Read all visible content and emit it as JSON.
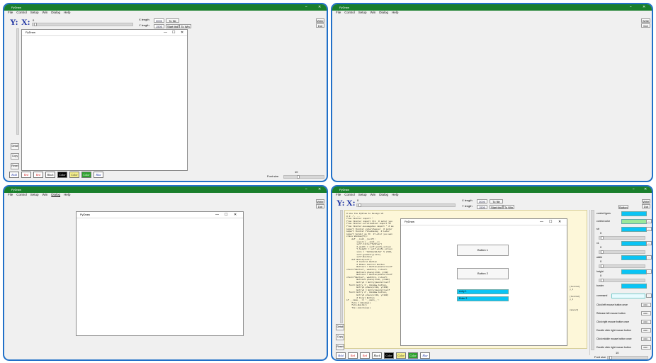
{
  "colors": {
    "title_bar": "#1a7f2c",
    "panel_border": "#2170c8",
    "editor_bg": "#fdf7d9",
    "cyan": "#0ac4f5",
    "lightgreen": "#9be89b"
  },
  "window": {
    "title": "PyDraw",
    "menu": [
      "File",
      "Control",
      "Setup",
      "Win",
      "Dialog",
      "Help"
    ]
  },
  "coords": {
    "y_label": "Y:",
    "x_label": "X:",
    "x_value": "0",
    "x_length_label": "X length",
    "x_length_value": "3000",
    "y_length_label": "Y length",
    "y_length_value": "1500",
    "to_file": "To file",
    "start_draw": "Start tbd",
    "to_win": "To Win",
    "write": "Write",
    "dot": "Dot"
  },
  "side_buttons": {
    "detail": "Detail",
    "copy": "Copy",
    "reset": "Reset"
  },
  "child_window": {
    "title": "PyDraw",
    "minimize": "—",
    "maximize": "☐",
    "close": "✕"
  },
  "color_buttons": [
    "Red",
    "Red",
    "Black",
    "Color",
    "Color",
    "Color",
    "Color",
    "Blue"
  ],
  "font_size": {
    "label": "Font size",
    "value": "10"
  },
  "p2": {
    "write": "Write",
    "dot": "Dot"
  },
  "p4": {
    "code": [
      "# Use the PyDraw to Design UI",
      "# # -*- ...",
      "from tkinter import *",
      "from tkinter import ttk  # Later you",
      "from tkinter.scrolledtext import ST",
      "from tkinter.messagebox import * # me",
      "import tkinter.colorchooser  # Later",
      "import tkinter.filedialog  # Later",
      "import holder as th  # Later you wan",
      "",
      "class Window(Tk):",
      "    def __init__(self):",
      "        super().__init__()",
      "        self.title(\"PyDraw\")",
      "        X_width = self.winfo_screen",
      "        Y_height = self.winfo_screen",
      "        size = '%dx%d+%d+%d' % (600,",
      "        self.geometry(size)",
      "        self.Build()",
      "",
      "    def Build(self):",
      "        # Control Button",
      "",
      "        # Dbase Control Button",
      "",
      "        Button1 = Button(master=self",
      "xText=\"Button\", width=1, relief=",
      "        Button1.place(x=20, y=40)",
      "",
      "        Button2 = Button(master=self",
      "xText=\"Button\", width=1, relief=",
      "        Button2.place(x=20, y=100)",
      "",
      "        Entry1 = Entry(master=self",
      "  font= Entry 1', Window.button,",
      "        Entry1.place(x=20, y=150)",
      "",
      "        Entry2 = Entry(master=self",
      "  font= Entry 2', Window.button,",
      "        Entry2.place(x=20, y=180)",
      "",
      "        # Final Button",
      "",
      "if __name__ == '__main__':",
      "    form = Window()",
      "    form.Build()",
      "    Tk().mainloop()"
    ],
    "button1": "Button 1",
    "button2": "Button 2",
    "entry1": "entry 1",
    "entry2": "Enter 2",
    "edge": [
      "[textid]",
      "y_1",
      "[textid]",
      "y_1",
      "cancel]"
    ],
    "props": [
      {
        "label": "control types"
      },
      {
        "label": "control color"
      },
      {
        "label": "str",
        "value": "0"
      },
      {
        "label": "x1",
        "value": "0"
      },
      {
        "label": "width",
        "value": "0"
      },
      {
        "label": "height",
        "value": "0"
      },
      {
        "label": "border"
      }
    ],
    "command": "command",
    "events": [
      "Click left mouse button once",
      "Release left mouse button",
      "Click right mouse button once",
      "Double click right mouse button",
      "Click middle mouse button once",
      "Double click right mouse button"
    ],
    "event_btn": "Add...",
    "button_label": "Button"
  }
}
